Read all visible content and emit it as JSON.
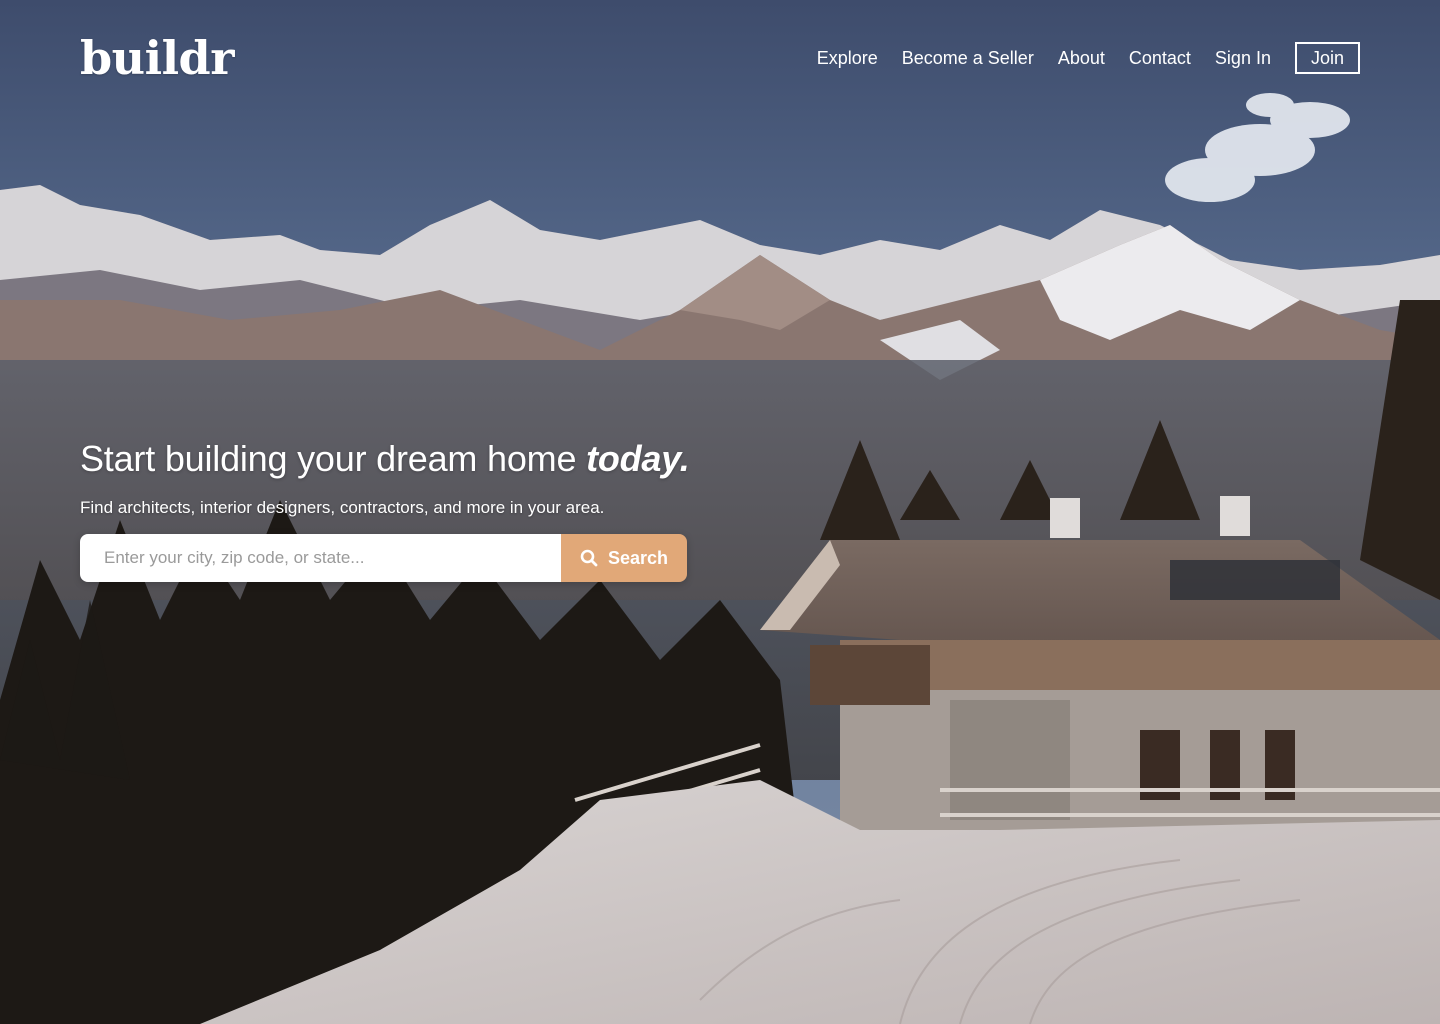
{
  "brand": {
    "name": "buildr"
  },
  "nav": {
    "items": [
      {
        "label": "Explore"
      },
      {
        "label": "Become a Seller"
      },
      {
        "label": "About"
      },
      {
        "label": "Contact"
      },
      {
        "label": "Sign In"
      }
    ],
    "join_label": "Join"
  },
  "hero": {
    "headline": "Start building your dream home ",
    "headline_emphasis": "today.",
    "subheadline": "Find architects, interior designers, contractors, and more in your area.",
    "search": {
      "placeholder": "Enter your city, zip code, or state...",
      "button_label": "Search",
      "button_icon": "search-icon"
    }
  },
  "colors": {
    "accent": "#e1a878",
    "text_on_image": "#ffffff",
    "sky": "#4a5a7a"
  }
}
